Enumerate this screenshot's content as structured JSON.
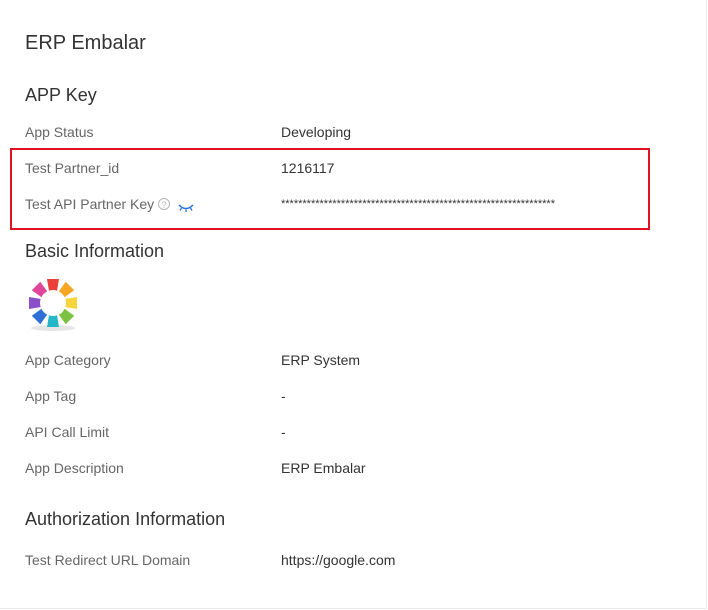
{
  "app": {
    "title": "ERP Embalar"
  },
  "app_key": {
    "section_title": "APP Key",
    "status_label": "App Status",
    "status_value": "Developing",
    "partner_id_label": "Test Partner_id",
    "partner_id_value": "1216117",
    "api_key_label": "Test API Partner Key",
    "api_key_value": "****************************************************************"
  },
  "basic_info": {
    "section_title": "Basic Information",
    "logo_text": "LOREM IPSUM",
    "category_label": "App Category",
    "category_value": "ERP System",
    "tag_label": "App Tag",
    "tag_value": "-",
    "api_limit_label": "API Call Limit",
    "api_limit_value": "-",
    "description_label": "App Description",
    "description_value": "ERP Embalar"
  },
  "authorization": {
    "section_title": "Authorization Information",
    "redirect_label": "Test Redirect URL Domain",
    "redirect_value": "https://google.com"
  },
  "icons": {
    "help": "question-circle-icon",
    "reveal": "eye-closed-icon"
  },
  "colors": {
    "highlight": "#e0141e",
    "link": "#2673dd",
    "label": "#666666",
    "text": "#333333"
  }
}
